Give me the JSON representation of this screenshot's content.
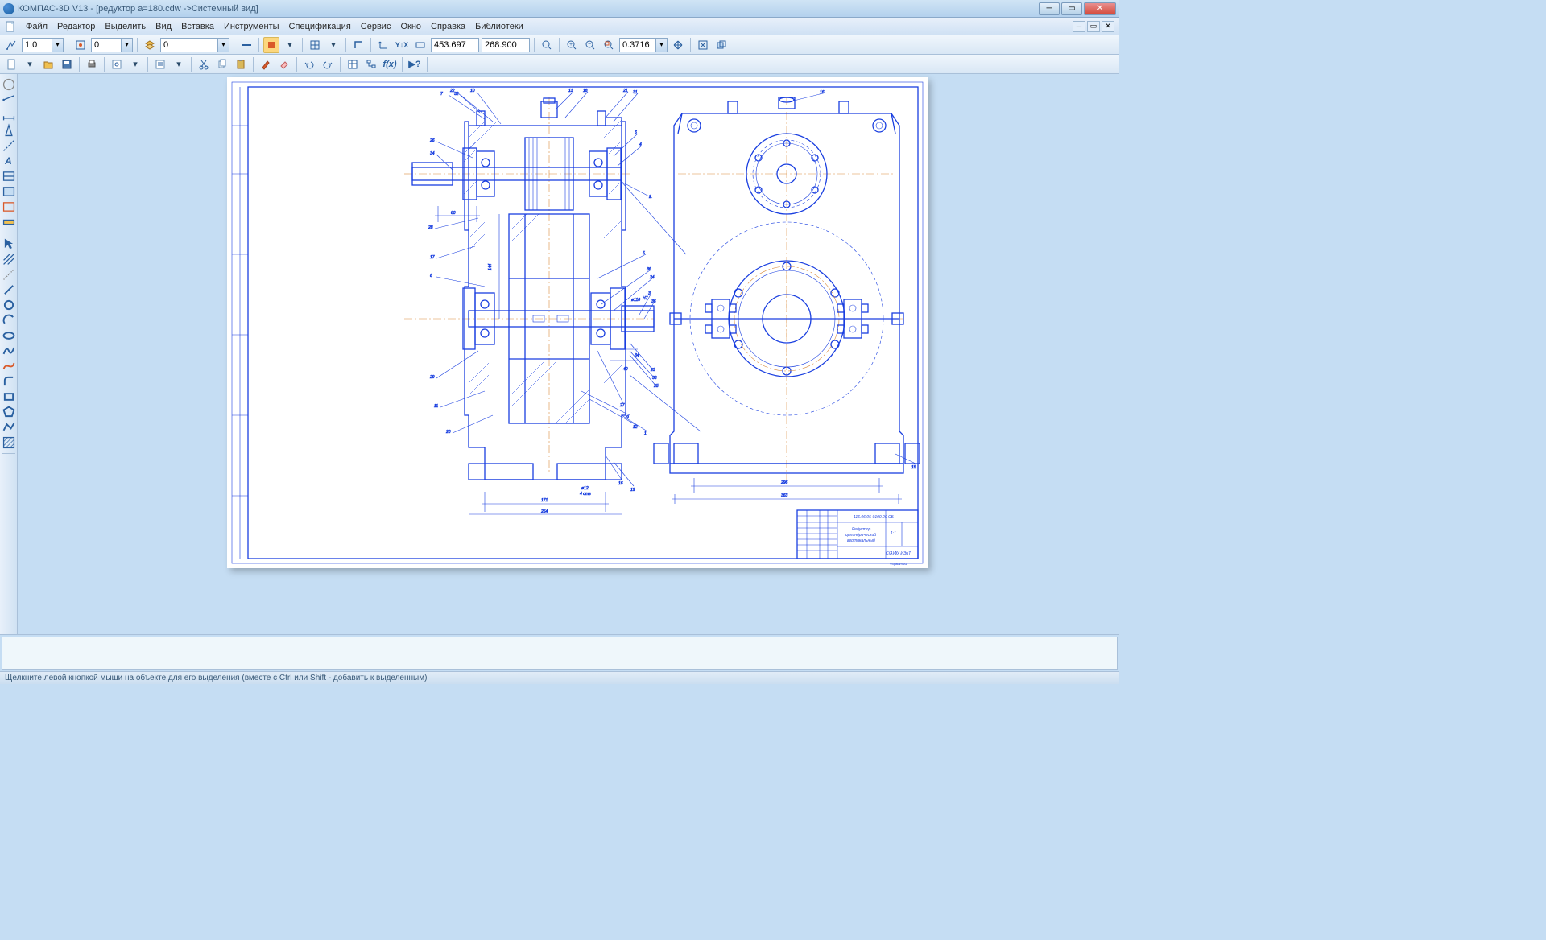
{
  "title": "КОМПАС-3D V13 - [редуктор a=180.cdw ->Системный вид]",
  "menu": {
    "items": [
      "Файл",
      "Редактор",
      "Выделить",
      "Вид",
      "Вставка",
      "Инструменты",
      "Спецификация",
      "Сервис",
      "Окно",
      "Справка",
      "Библиотеки"
    ]
  },
  "toolbar1": {
    "step": "1.0",
    "val2": "0",
    "style_val": "0",
    "coord_x": "453.697",
    "coord_y": "268.900",
    "zoom": "0.3716"
  },
  "statusbar": {
    "hint": "Щелкните левой кнопкой мыши на объекте для его выделения (вместе с Ctrl или Shift - добавить к выделенным)"
  },
  "cmd_placeholder": "",
  "drawing": {
    "frame_inset": 8,
    "title_block": {
      "doc_no": "116.06.05-0100.00 СБ",
      "name_line1": "Редуктор",
      "name_line2": "цилиндрический",
      "name_line3": "вертикальный",
      "org": "С(А)ФУ ИЭиТ",
      "sheet": "1:1",
      "material": "",
      "format": "Формат А1"
    },
    "callouts": [
      "1",
      "2",
      "3",
      "4",
      "5",
      "6",
      "7",
      "8",
      "9",
      "10",
      "11",
      "12",
      "13",
      "15",
      "16",
      "17",
      "18",
      "19",
      "20",
      "21",
      "22",
      "23",
      "24",
      "25",
      "26",
      "27",
      "28",
      "29",
      "30",
      "31",
      "32",
      "33",
      "34",
      "35",
      "36"
    ],
    "dims": {
      "width_296": "296",
      "width_363": "363",
      "d12": "ø12",
      "holes": "4 отв",
      "len_171": "171",
      "len_254": "254",
      "len_80": "80",
      "len_40": "40",
      "len_34": "34",
      "len_144": "144",
      "d110": "ø110",
      "h7": "H7"
    }
  }
}
